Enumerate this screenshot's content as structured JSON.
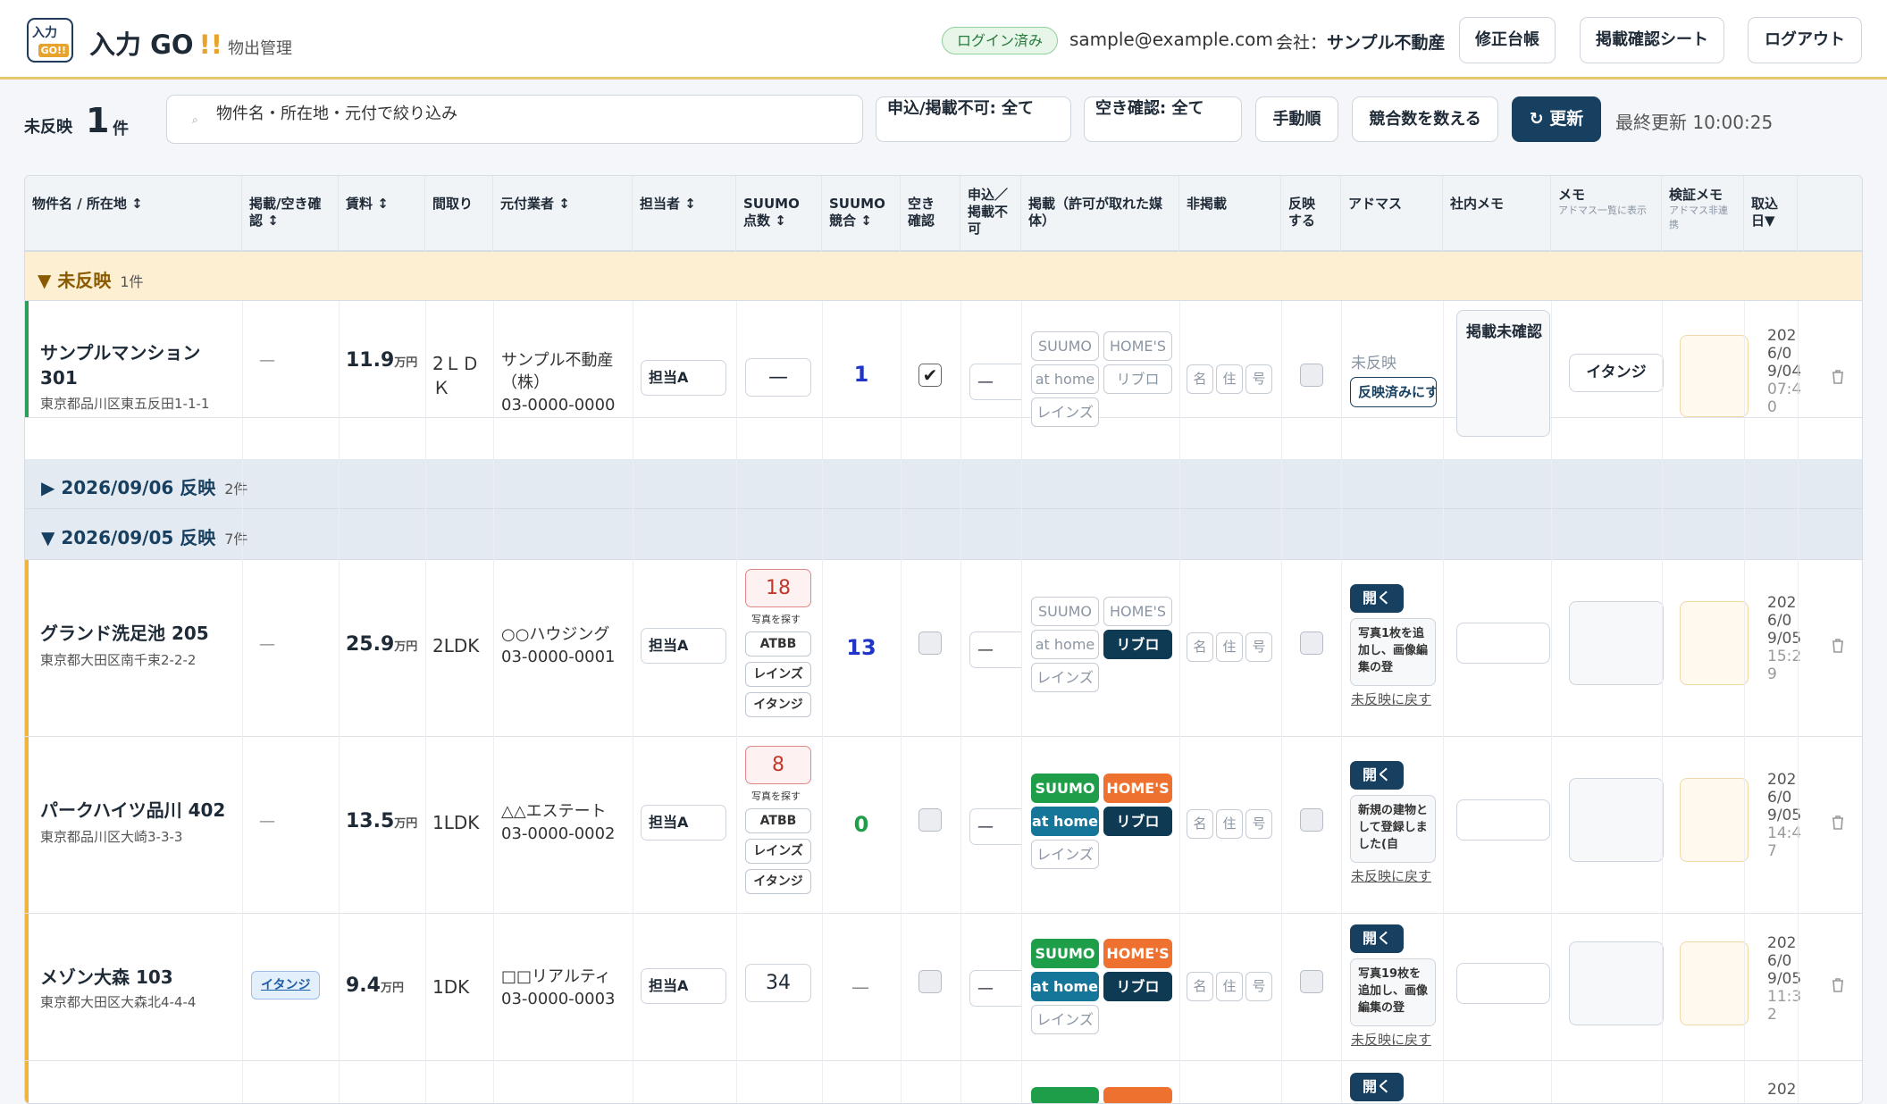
{
  "header": {
    "logo_top": "入力",
    "logo_bottom": "GO!!",
    "brand_name": "入力 GO",
    "brand_bang": "!!",
    "brand_sub": "物出管理",
    "login_badge": "ログイン済み",
    "email": "sample@example.com",
    "company_label": "会社：",
    "company_name": "サンプル不動産",
    "buttons": [
      "修正台帳",
      "掲載確認シート",
      "ログアウト"
    ]
  },
  "toolbar": {
    "unreflected_label": "未反映",
    "unreflected_count": "1",
    "unreflected_unit": "件",
    "search_placeholder": "物件名・所在地・元付で絞り込み",
    "filter_apply": "申込/掲載不可: 全て",
    "filter_vacancy": "空き確認: 全て",
    "btn_procedure": "手動順",
    "btn_count": "競合数を数える",
    "btn_refresh": "更新",
    "last_updated": "最終更新 10:00:25"
  },
  "columns": [
    {
      "label": "物件名 / 所在地 ↕"
    },
    {
      "label": "掲載/空き確認 ↕"
    },
    {
      "label": "賃料 ↕"
    },
    {
      "label": "間取り"
    },
    {
      "label": "元付業者 ↕"
    },
    {
      "label": "担当者 ↕"
    },
    {
      "label": "SUUMO 点数 ↕"
    },
    {
      "label": "SUUMO 競合 ↕"
    },
    {
      "label": "空き 確認"
    },
    {
      "label": "申込／掲載不可"
    },
    {
      "label": "掲載（許可が取れた媒体）"
    },
    {
      "label": "非掲載"
    },
    {
      "label": "反映 する"
    },
    {
      "label": "アドマス"
    },
    {
      "label": "社内メモ"
    },
    {
      "label": "メモ",
      "note": "アドマス一覧に表示"
    },
    {
      "label": "検証メモ",
      "note": "アドマス非連携"
    },
    {
      "label": "取込日▼"
    }
  ],
  "sections": {
    "unreflected": {
      "label": "▼ 未反映",
      "count": "1件"
    },
    "d0906": {
      "label": "▶ 2026/09/06 反映",
      "count": "2件"
    },
    "d0905": {
      "label": "▼ 2026/09/05 反映",
      "count": "7件"
    }
  },
  "common": {
    "photo_search": "写真を探す",
    "atbb": "ATBB",
    "reins": "レインズ",
    "itanji": "イタンジ",
    "media_suumo": "SUUMO",
    "media_homes": "HOME'S",
    "media_athome": "at home",
    "media_ribro": "リブロ",
    "media_reins": "レインズ",
    "chip_name": "名",
    "chip_addr": "住",
    "chip_num": "号",
    "open": "開く",
    "revert": "未反映に戻す",
    "dash": "—",
    "rent_unit": "万円"
  },
  "rows": [
    {
      "name": "サンプルマンション 301",
      "address": "東京都品川区東五反田1-1-1",
      "status": "—",
      "rent": "11.9",
      "layout": "2ＬＤＫ",
      "agent_name": "サンプル不動産（株）",
      "agent_tel": "03-0000-0000",
      "assignee": "担当A",
      "suumo_score": "—",
      "competitors": "1",
      "vacancy_checked": true,
      "application": "—",
      "adomas_status": "未反映",
      "adomas_action": "反映済みにする",
      "internal_memo": "掲載未確認",
      "memo": "イタンジ",
      "import_date": "2026/09/04",
      "import_time": "07:40"
    },
    {
      "name": "グランド洗足池 205",
      "address": "東京都大田区南千束2-2-2",
      "status": "—",
      "rent": "25.9",
      "layout": "2LDK",
      "agent_name": "○○ハウジング",
      "agent_tel": "03-0000-0001",
      "assignee": "担当A",
      "suumo_score": "18",
      "competitors": "13",
      "vacancy_checked": false,
      "application": "—",
      "adomas_note": "写真1枚を追加し、画像編集の登",
      "import_date": "2026/09/05",
      "import_time": "15:29"
    },
    {
      "name": "パークハイツ品川 402",
      "address": "東京都品川区大崎3-3-3",
      "status": "—",
      "rent": "13.5",
      "layout": "1LDK",
      "agent_name": "△△エステート",
      "agent_tel": "03-0000-0002",
      "assignee": "担当A",
      "suumo_score": "8",
      "competitors": "0",
      "vacancy_checked": false,
      "application": "—",
      "adomas_note": "新規の建物として登録しました(自",
      "import_date": "2026/09/05",
      "import_time": "14:47"
    },
    {
      "name": "メゾン大森 103",
      "address": "東京都大田区大森北4-4-4",
      "status_tag": "イタンジ",
      "rent": "9.4",
      "layout": "1DK",
      "agent_name": "□□リアルティ",
      "agent_tel": "03-0000-0003",
      "assignee": "担当A",
      "suumo_score": "34",
      "competitors": "—",
      "vacancy_checked": false,
      "application": "—",
      "adomas_note": "写真19枚を追加し、画像編集の登",
      "import_date": "2026/09/05",
      "import_time": "11:32"
    },
    {
      "open_label": "開く",
      "import_date_partial": "202"
    }
  ],
  "colors": {
    "accent": "#173f5f",
    "unreflected_bar": "#2f9e5a",
    "reflected_bar": "#f2b33d",
    "section_unreflected_bg": "#fdf0d2",
    "section_date_bg": "#e4eaf1"
  }
}
